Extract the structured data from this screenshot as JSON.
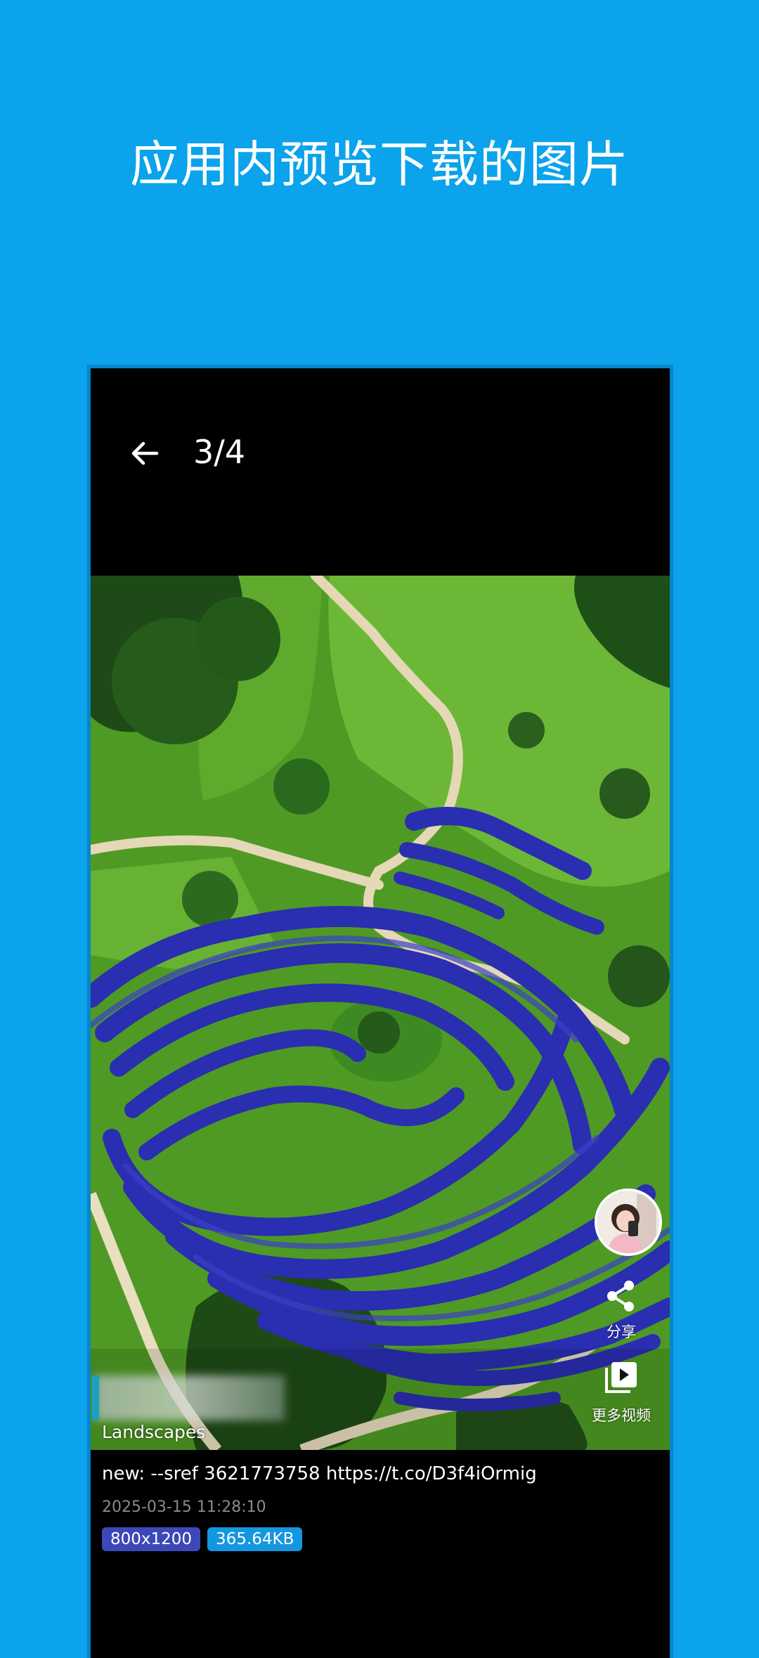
{
  "headline": "应用内预览下载的图片",
  "viewer": {
    "counter": "3/4",
    "album_label": "Landscapes",
    "actions": {
      "share_label": "分享",
      "more_videos_label": "更多视频"
    }
  },
  "details": {
    "prompt": "new: --sref 3621773758 https://t.co/D3f4iOrmig",
    "date": "2025-03-15 11:28:10",
    "resolution": "800x1200",
    "file_size": "365.64KB"
  },
  "colors": {
    "background": "#0aa3ec",
    "resolution_badge": "#3d48b8",
    "size_badge": "#1596e0"
  },
  "icons": {
    "back": "arrow-left-icon",
    "share": "share-icon",
    "more_videos": "video-library-icon"
  }
}
